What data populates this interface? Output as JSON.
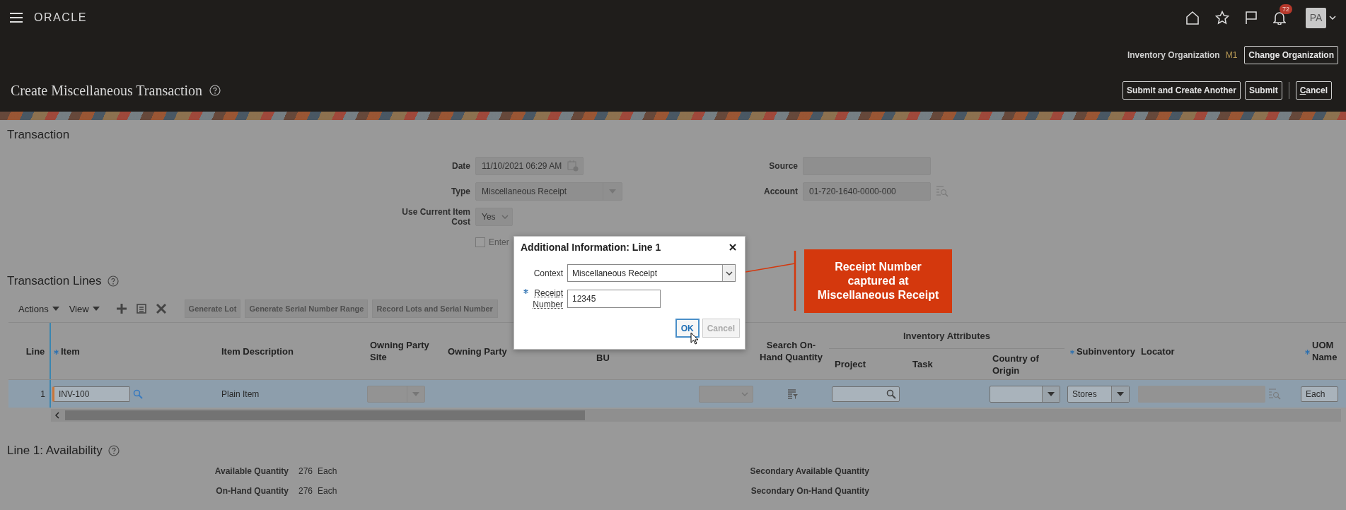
{
  "top_bar": {
    "logo": "ORACLE",
    "notification_count": "72",
    "avatar": "PA"
  },
  "context_bar": {
    "label": "Inventory Organization",
    "value": "M1",
    "button": "Change Organization"
  },
  "page_header": {
    "title": "Create Miscellaneous Transaction",
    "buttons": [
      {
        "label": "Submit and Create Another",
        "kind": "action"
      },
      {
        "label": "Submit",
        "kind": "action"
      },
      {
        "label": "Cancel",
        "kind": "cancel"
      }
    ]
  },
  "transaction": {
    "heading": "Transaction",
    "fields_left": [
      {
        "label": "Date",
        "value": "11/10/2021 06:29 AM",
        "kind": "date"
      },
      {
        "label": "Type",
        "value": "Miscellaneous Receipt",
        "kind": "select"
      },
      {
        "label": "Use Current Item Cost",
        "value": "Yes",
        "kind": "choice"
      }
    ],
    "checkbox": {
      "label": "Enter",
      "checked": false
    },
    "fields_right": [
      {
        "label": "Source",
        "kind": "text"
      },
      {
        "label": "Account",
        "value": "01-720-1640-0000-000",
        "kind": "lookup"
      }
    ]
  },
  "transaction_lines": {
    "heading": "Transaction Lines",
    "menus": [
      "Actions",
      "View"
    ],
    "toolbar_buttons": [
      "Generate Lot",
      "Generate Serial Number Range",
      "Record Lots and Serial Number"
    ],
    "group_header": "Inventory Attributes",
    "columns": [
      {
        "label": "Line"
      },
      {
        "label": "Item",
        "required": true
      },
      {
        "label": "Item Description"
      },
      {
        "label": "Owning Party Site"
      },
      {
        "label": "Owning Party"
      },
      {
        "label": "BU"
      },
      {},
      {
        "label": "Search On-Hand Quantity"
      },
      {
        "label": "Project",
        "grouped": true
      },
      {
        "label": "Task",
        "grouped": true
      },
      {
        "label": "Country of Origin",
        "grouped": true
      },
      {
        "label": "Subinventory",
        "required": true
      },
      {
        "label": "Locator"
      },
      {
        "label": "UOM Name",
        "required": true
      }
    ],
    "rows": [
      {
        "selected": true,
        "cells": [
          {
            "kind": "number",
            "value": "1"
          },
          {
            "kind": "input",
            "value": "INV-100"
          },
          {
            "kind": "text",
            "value": "Plain Item"
          },
          {
            "kind": "select",
            "disabled": true
          },
          {
            "kind": "empty"
          },
          {
            "kind": "empty"
          },
          {
            "kind": "select",
            "disabled": true
          },
          {
            "kind": "icon"
          },
          {
            "kind": "search"
          },
          {
            "kind": "empty"
          },
          {
            "kind": "select",
            "disabled": false
          },
          {
            "kind": "select",
            "disabled": false,
            "value": "Stores"
          },
          {
            "kind": "lookup",
            "disabled": true
          },
          {
            "kind": "input",
            "value": "Each"
          }
        ]
      }
    ]
  },
  "availability": {
    "heading": "Line 1: Availability",
    "rows": [
      {
        "label": "Available Quantity",
        "value": "276",
        "unit": "Each"
      },
      {
        "label": "On-Hand Quantity",
        "value": "276",
        "unit": "Each"
      }
    ],
    "secondary": [
      {
        "label": "Secondary Available Quantity"
      },
      {
        "label": "Secondary On-Hand Quantity"
      }
    ]
  },
  "dialog": {
    "title": "Additional Information: Line 1",
    "fields": [
      {
        "label": "Context",
        "value": "Miscellaneous Receipt",
        "kind": "select"
      },
      {
        "label": "Receipt Number",
        "value": "12345",
        "kind": "text",
        "required": true
      }
    ],
    "buttons": [
      {
        "label": "OK",
        "focused": true,
        "disabled": false
      },
      {
        "label": "Cancel",
        "focused": false,
        "disabled": true
      }
    ]
  },
  "annotation": {
    "text": "Receipt Number captured at Miscellaneous Receipt"
  }
}
